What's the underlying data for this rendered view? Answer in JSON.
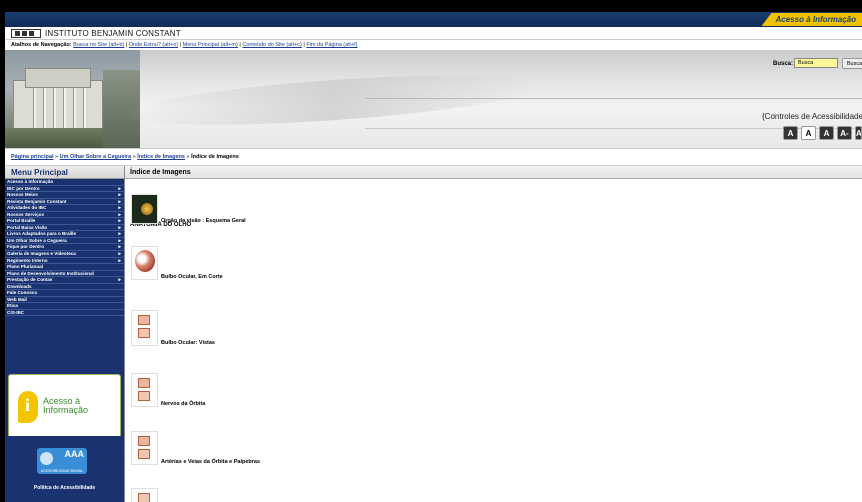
{
  "gov_bar": {
    "link": "Acesso à Informação"
  },
  "institute": {
    "name": "INSTITUTO BENJAMIN CONSTANT"
  },
  "shortcuts": {
    "label": "Atalhos de Navegação:",
    "links": [
      "Busca no Site (alt+b)",
      "Onde Estou? (alt+o)",
      "Menu Principal (alt+m)",
      "Conteúdo do Site (alt+c)",
      "Fim da Página (alt+f)"
    ]
  },
  "search": {
    "label": "Busca:",
    "value": "Busca",
    "button": "Busca"
  },
  "accessibility": {
    "title": "{Controles de Acessibilidade}",
    "buttons": [
      "A",
      "A",
      "A",
      "A-",
      "A+"
    ]
  },
  "breadcrumb": {
    "items": [
      "Página principal",
      "Um Olhar Sobre a Cegueira",
      "Índice de Imagens"
    ],
    "current": "Índice de Imagens",
    "sep": "»"
  },
  "sidebar": {
    "title": "Menu Principal",
    "items": [
      {
        "label": "Acesso à Informação",
        "arrow": false
      },
      {
        "label": "IBC por Dentro",
        "arrow": true
      },
      {
        "label": "Nossos Meios",
        "arrow": true
      },
      {
        "label": "Revista Benjamin Constant",
        "arrow": true
      },
      {
        "label": "Atividades do IBC",
        "arrow": true
      },
      {
        "label": "Nossos Serviços",
        "arrow": true
      },
      {
        "label": "Portal Braille",
        "arrow": true
      },
      {
        "label": "Portal Baixa Visão",
        "arrow": true
      },
      {
        "label": "Livros Adaptados para o Braille",
        "arrow": true
      },
      {
        "label": "Um Olhar Sobre a Cegueira",
        "arrow": true
      },
      {
        "label": "Fique por Dentro",
        "arrow": true
      },
      {
        "label": "Galeria de Imagens e Videoteca",
        "arrow": true
      },
      {
        "label": "Regimento Interno",
        "arrow": true
      },
      {
        "label": "Plano Plurianual",
        "arrow": false
      },
      {
        "label": "Plano de Desenvolvimento Institucional",
        "arrow": false
      },
      {
        "label": "Prestação de Contas",
        "arrow": true
      },
      {
        "label": "Downloads",
        "arrow": false
      },
      {
        "label": "Fale Conosco",
        "arrow": false
      },
      {
        "label": "Web Mail",
        "arrow": false
      },
      {
        "label": "Ética",
        "arrow": false
      },
      {
        "label": "CIS-IBC",
        "arrow": false
      }
    ],
    "acesso_info": {
      "line1": "Acesso à",
      "line2": "Informação"
    },
    "aaa": {
      "badge": "AAA",
      "sub": "APROVADO",
      "caption": "ACESSIBILIDADE BRASIL"
    },
    "politica": "Política de Acessibilidade"
  },
  "main": {
    "title": "Índice de Imagens",
    "section": "ANATOMIA DO OLHO",
    "images": [
      "Orgão da visão : Esquema Geral",
      "Bulbo Ocular, Em Corte",
      "Bulbo Ocular: Vistas",
      "Nervos da Órbita",
      "Artérias e Veias da Órbita e Palpebras"
    ]
  }
}
